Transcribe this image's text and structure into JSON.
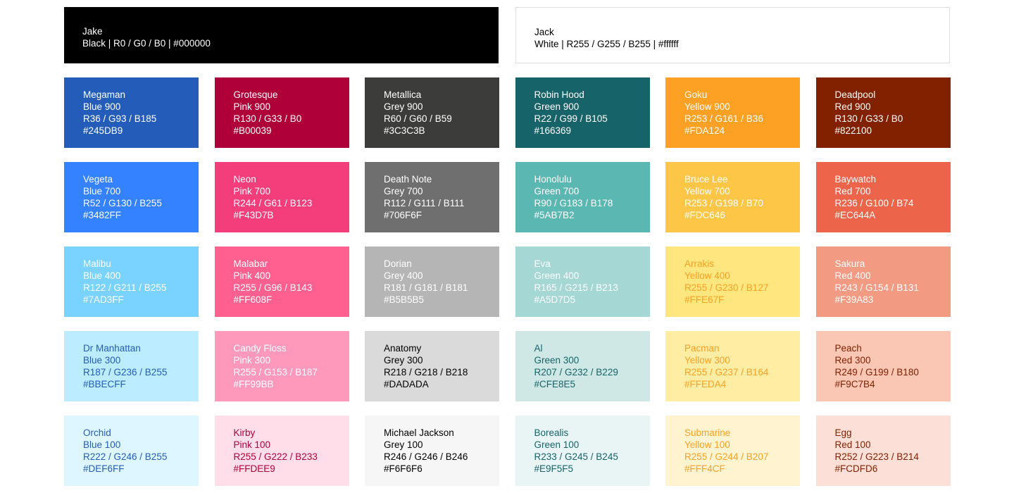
{
  "top": [
    {
      "name": "Jake",
      "desc": "Black | R0 / G0 / B0 | #000000",
      "bg": "#000000",
      "fg": "#ffffff"
    },
    {
      "name": "Jack",
      "desc": "White | R255 / G255 / B255 | #ffffff",
      "bg": "#ffffff",
      "fg": "#000000"
    }
  ],
  "swatches": [
    {
      "name": "Megaman",
      "shade": "Blue 900",
      "rgb": "R36 / G93 / B185",
      "hex": "#245DB9",
      "bg": "#245DB9",
      "fg": "#ffffff"
    },
    {
      "name": "Grotesque",
      "shade": "Pink 900",
      "rgb": "R130 / G33 / B0",
      "hex": "#B00039",
      "bg": "#B00039",
      "fg": "#ffffff"
    },
    {
      "name": "Metallica",
      "shade": "Grey 900",
      "rgb": "R60 / G60 / B59",
      "hex": "#3C3C3B",
      "bg": "#3C3C3B",
      "fg": "#ffffff"
    },
    {
      "name": "Robin Hood",
      "shade": "Green 900",
      "rgb": "R22 / G99 / B105",
      "hex": "#166369",
      "bg": "#166369",
      "fg": "#ffffff"
    },
    {
      "name": "Goku",
      "shade": "Yellow 900",
      "rgb": "R253 / G161 / B36",
      "hex": "#FDA124",
      "bg": "#FDA124",
      "fg": "#ffffff"
    },
    {
      "name": "Deadpool",
      "shade": "Red 900",
      "rgb": "R130 / G33 / B0",
      "hex": "#822100",
      "bg": "#822100",
      "fg": "#ffffff"
    },
    {
      "name": "Vegeta",
      "shade": "Blue 700",
      "rgb": "R52 / G130 / B255",
      "hex": "#3482FF",
      "bg": "#3482FF",
      "fg": "#ffffff"
    },
    {
      "name": "Neon",
      "shade": "Pink 700",
      "rgb": "R244 / G61 / B123",
      "hex": "#F43D7B",
      "bg": "#F43D7B",
      "fg": "#ffffff"
    },
    {
      "name": "Death Note",
      "shade": "Grey 700",
      "rgb": "R112 / G111 / B111",
      "hex": "#706F6F",
      "bg": "#706F6F",
      "fg": "#ffffff"
    },
    {
      "name": "Honolulu",
      "shade": "Green 700",
      "rgb": "R90 / G183 / B178",
      "hex": "#5AB7B2",
      "bg": "#5AB7B2",
      "fg": "#ffffff"
    },
    {
      "name": "Bruce Lee",
      "shade": "Yellow 700",
      "rgb": "R253 / G198 / B70",
      "hex": "#FDC646",
      "bg": "#FDC646",
      "fg": "#ffffff"
    },
    {
      "name": "Baywatch",
      "shade": "Red 700",
      "rgb": "R236 / G100 / B74",
      "hex": "#EC644A",
      "bg": "#EC644A",
      "fg": "#ffffff"
    },
    {
      "name": "Malibu",
      "shade": "Blue 400",
      "rgb": "R122 / G211 / B255",
      "hex": "#7AD3FF",
      "bg": "#7AD3FF",
      "fg": "#ffffff"
    },
    {
      "name": "Malabar",
      "shade": "Pink 400",
      "rgb": "R255 / G96 / B143",
      "hex": "#FF608F",
      "bg": "#FF608F",
      "fg": "#ffffff"
    },
    {
      "name": "Dorian",
      "shade": "Grey 400",
      "rgb": "R181 / G181 / B181",
      "hex": "#B5B5B5",
      "bg": "#B5B5B5",
      "fg": "#ffffff"
    },
    {
      "name": "Eva",
      "shade": "Green 400",
      "rgb": "R165 / G215 / B213",
      "hex": "#A5D7D5",
      "bg": "#A5D7D5",
      "fg": "#ffffff"
    },
    {
      "name": "Arrakis",
      "shade": "Yellow 400",
      "rgb": "R255 / G230 / B127",
      "hex": "#FFE67F",
      "bg": "#FFE67F",
      "fg": "#FDA124"
    },
    {
      "name": "Sakura",
      "shade": "Red 400",
      "rgb": "R243 / G154 / B131",
      "hex": "#F39A83",
      "bg": "#F39A83",
      "fg": "#ffffff"
    },
    {
      "name": "Dr Manhattan",
      "shade": "Blue 300",
      "rgb": "R187 / G236 / B255",
      "hex": "#BBECFF",
      "bg": "#BBECFF",
      "fg": "#245DB9"
    },
    {
      "name": "Candy Floss",
      "shade": "Pink 300",
      "rgb": "R255 / G153 / B187",
      "hex": "#FF99BB",
      "bg": "#FF99BB",
      "fg": "#ffffff"
    },
    {
      "name": "Anatomy",
      "shade": "Grey 300",
      "rgb": "R218 / G218 / B218",
      "hex": "#DADADA",
      "bg": "#DADADA",
      "fg": "#000000"
    },
    {
      "name": "Al",
      "shade": "Green 300",
      "rgb": "R207 / G232 / B229",
      "hex": "#CFE8E5",
      "bg": "#CFE8E5",
      "fg": "#166369"
    },
    {
      "name": "Pacman",
      "shade": "Yellow 300",
      "rgb": "R255 / G237 / B164",
      "hex": "#FFEDA4",
      "bg": "#FFEDA4",
      "fg": "#FDA124"
    },
    {
      "name": "Peach",
      "shade": "Red 300",
      "rgb": "R249 / G199 / B180",
      "hex": "#F9C7B4",
      "bg": "#F9C7B4",
      "fg": "#822100"
    },
    {
      "name": "Orchid",
      "shade": "Blue 100",
      "rgb": "R222 / G246 / B255",
      "hex": "#DEF6FF",
      "bg": "#DEF6FF",
      "fg": "#245DB9"
    },
    {
      "name": "Kirby",
      "shade": "Pink 100",
      "rgb": "R255 / G222 / B233",
      "hex": "#FFDEE9",
      "bg": "#FFDEE9",
      "fg": "#B00039"
    },
    {
      "name": "Michael Jackson",
      "shade": "Grey 100",
      "rgb": "R246 / G246 / B246",
      "hex": "#F6F6F6",
      "bg": "#F6F6F6",
      "fg": "#000000"
    },
    {
      "name": "Borealis",
      "shade": "Green 100",
      "rgb": "R233 / G245 / B245",
      "hex": "#E9F5F5",
      "bg": "#E9F5F5",
      "fg": "#166369"
    },
    {
      "name": "Submarine",
      "shade": "Yellow 100",
      "rgb": "R255 / G244 / B207",
      "hex": "#FFF4CF",
      "bg": "#FFF4CF",
      "fg": "#FDA124"
    },
    {
      "name": "Egg",
      "shade": "Red 100",
      "rgb": "R252 / G223 / B214",
      "hex": "#FCDFD6",
      "bg": "#FCDFD6",
      "fg": "#822100"
    }
  ]
}
